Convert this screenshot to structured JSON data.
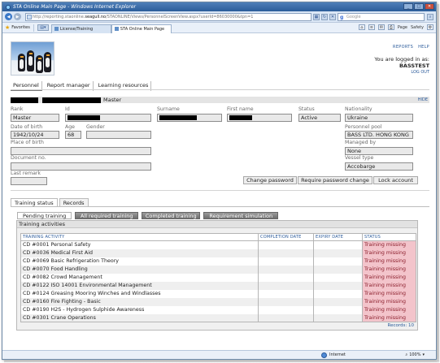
{
  "browser": {
    "title": "STA Online Main Page - Windows Internet Explorer",
    "address_prefix": "http://reporting.staonline.",
    "address_domain": "seagull.no",
    "address_suffix": "/STAONLINE/Views/PersonnelScreenView.aspx?userId=86030000&tpn=1",
    "search_placeholder": "Google",
    "favorites_label": "Favorites",
    "tabs": [
      "License/Training",
      "STA Online Main Page"
    ],
    "commands": [
      "Page",
      "Safety"
    ],
    "status_zone": "Internet",
    "zoom": "100%"
  },
  "app": {
    "links": [
      "REPORTS",
      "HELP"
    ],
    "logged_in_label": "You are logged in as:",
    "username": "BASSTEST",
    "logout": "LOG OUT",
    "main_tabs": [
      "Personnel",
      "Report manager",
      "Learning resources"
    ],
    "name_suffix": "Master",
    "hide_link": "HIDE"
  },
  "profile": {
    "rank_label": "Rank",
    "rank": "Master",
    "id_label": "Id",
    "surname_label": "Surname",
    "firstname_label": "First name",
    "status_label": "Status",
    "status": "Active",
    "nationality_label": "Nationality",
    "nationality": "Ukraine",
    "dob_label": "Date of birth",
    "dob": "1942/10/24",
    "age_label": "Age",
    "age": "68",
    "gender_label": "Gender",
    "gender": "",
    "pool_label": "Personnel pool",
    "pool": "BASS LTD. HONG KONG",
    "pob_label": "Place of birth",
    "pob": "",
    "managed_label": "Managed by",
    "managed": "None",
    "docno_label": "Document no.",
    "docno": "",
    "vessel_label": "Vessel type",
    "vessel": "Accobarge",
    "remark_label": "Last remark",
    "remark": ""
  },
  "actions": [
    "Change password",
    "Require password change",
    "Lock account"
  ],
  "lower_tabs": [
    "Training status",
    "Records"
  ],
  "sub_tabs": [
    "Pending training",
    "All required training",
    "Completed training",
    "Requirement simulation"
  ],
  "panel_title": "Training activities",
  "table": {
    "headers": [
      "TRAINING ACTIVITY",
      "COMPLETION DATE",
      "EXPIRY DATE",
      "STATUS"
    ],
    "rows": [
      [
        "CD #0001 Personal Safety",
        "",
        "",
        "Training missing"
      ],
      [
        "CD #0036 Medical First Aid",
        "",
        "",
        "Training missing"
      ],
      [
        "CD #0069 Basic Refrigeration Theory",
        "",
        "",
        "Training missing"
      ],
      [
        "CD #0070 Food Handling",
        "",
        "",
        "Training missing"
      ],
      [
        "CD #0082 Crowd Management",
        "",
        "",
        "Training missing"
      ],
      [
        "CD #0122 ISO 14001 Environmental Management",
        "",
        "",
        "Training missing"
      ],
      [
        "CD #0124 Greasing Mooring Winches and Windlasses",
        "",
        "",
        "Training missing"
      ],
      [
        "CD #0160 Fire Fighting - Basic",
        "",
        "",
        "Training missing"
      ],
      [
        "CD #0190 H2S - Hydrogen Sulphide Awareness",
        "",
        "",
        "Training missing"
      ],
      [
        "CD #0301 Crane Operations",
        "",
        "",
        "Training missing"
      ]
    ],
    "records": "Records: 10"
  }
}
